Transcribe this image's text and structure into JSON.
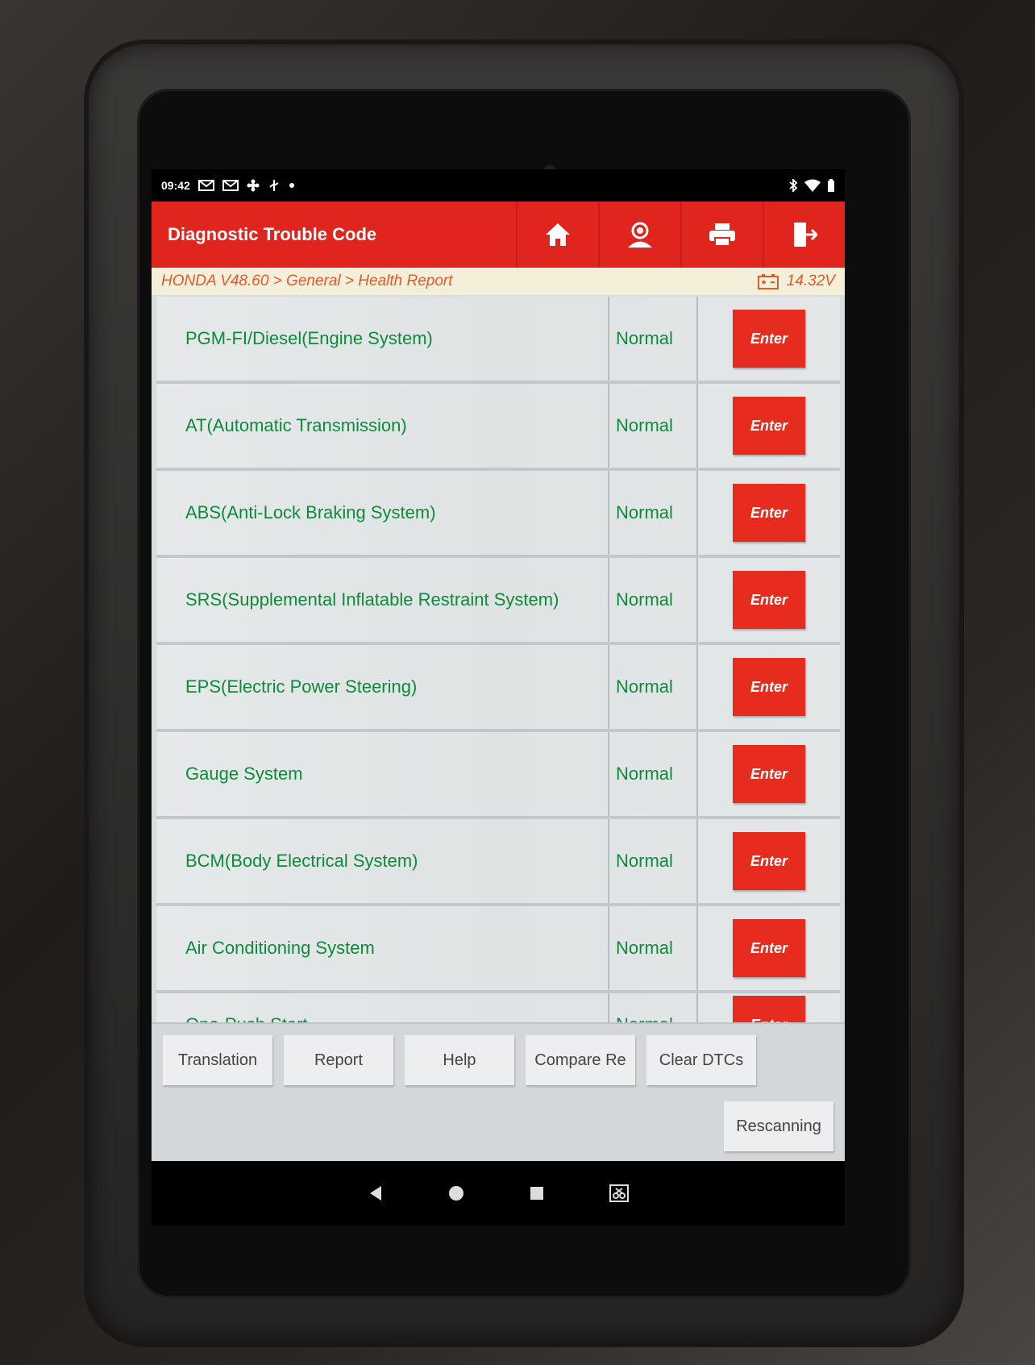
{
  "statusbar": {
    "time": "09:42",
    "left_icons": [
      "carrier-icon",
      "mail-icon",
      "mail-icon",
      "fan-icon",
      "usb-icon",
      "dot-icon"
    ],
    "right_icons": [
      "bluetooth-icon",
      "wifi-icon",
      "battery-icon"
    ]
  },
  "header": {
    "title": "Diagnostic Trouble Code",
    "buttons": [
      "home-icon",
      "user-icon",
      "printer-icon",
      "exit-icon"
    ]
  },
  "breadcrumb": {
    "path": "HONDA V48.60 > General > Health Report",
    "voltage": "14.32V"
  },
  "systems": [
    {
      "name": "PGM-FI/Diesel(Engine System)",
      "status": "Normal",
      "action": "Enter"
    },
    {
      "name": "AT(Automatic Transmission)",
      "status": "Normal",
      "action": "Enter"
    },
    {
      "name": "ABS(Anti-Lock Braking System)",
      "status": "Normal",
      "action": "Enter"
    },
    {
      "name": "SRS(Supplemental Inflatable Restraint System)",
      "status": "Normal",
      "action": "Enter"
    },
    {
      "name": "EPS(Electric Power Steering)",
      "status": "Normal",
      "action": "Enter"
    },
    {
      "name": "Gauge System",
      "status": "Normal",
      "action": "Enter"
    },
    {
      "name": "BCM(Body Electrical System)",
      "status": "Normal",
      "action": "Enter"
    },
    {
      "name": "Air Conditioning System",
      "status": "Normal",
      "action": "Enter"
    },
    {
      "name": "One-Push Start",
      "status": "Normal",
      "action": "Enter"
    }
  ],
  "bottom_buttons": [
    "Translation",
    "Report",
    "Help",
    "Compare Re",
    "Clear DTCs"
  ],
  "rescan_label": "Rescanning",
  "colors": {
    "accent_red": "#e0241e",
    "status_green": "#0f8a3a",
    "breadcrumb_orange": "#e15a2a"
  }
}
